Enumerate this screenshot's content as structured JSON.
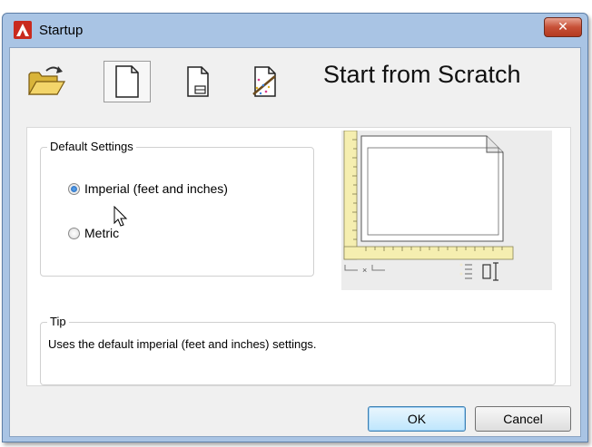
{
  "window": {
    "title": "Startup",
    "close_label": "✕"
  },
  "modes": {
    "current_title": "Start from Scratch",
    "items": [
      {
        "name": "open-drawing",
        "icon": "folder-open-icon"
      },
      {
        "name": "start-from-scratch",
        "icon": "blank-page-icon",
        "selected": true
      },
      {
        "name": "use-template",
        "icon": "template-page-icon"
      },
      {
        "name": "use-wizard",
        "icon": "wizard-icon"
      }
    ]
  },
  "default_settings": {
    "group_label": "Default Settings",
    "options": [
      {
        "label": "Imperial (feet and inches)",
        "checked": true
      },
      {
        "label": "Metric",
        "checked": false
      }
    ]
  },
  "tip": {
    "group_label": "Tip",
    "text": "Uses the default imperial (feet and inches) settings."
  },
  "buttons": {
    "ok": "OK",
    "cancel": "Cancel"
  },
  "colors": {
    "title_bar": "#a9c4e4",
    "close_button": "#c75037",
    "ruler": "#f5eeb0",
    "radio_selected": "#1c5fb3"
  }
}
